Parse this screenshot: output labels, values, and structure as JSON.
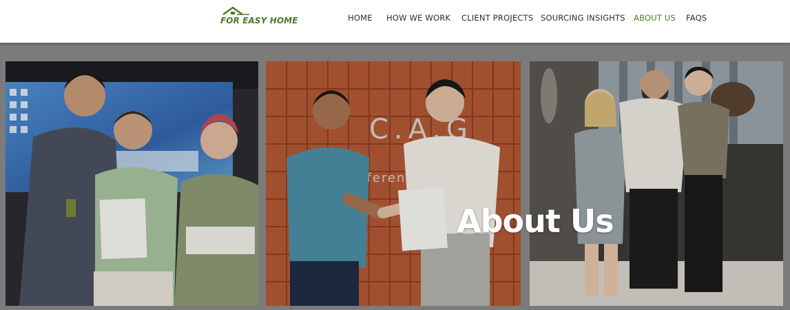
{
  "header": {
    "logo_text": "FOR EASY HOME",
    "nav": [
      {
        "label": "HOME"
      },
      {
        "label": "HOW WE WORK"
      },
      {
        "label": "CLIENT PROJECTS"
      },
      {
        "label": "SOURCING INSIGHTS"
      },
      {
        "label": "ABOUT US",
        "active": true
      },
      {
        "label": "FAQS"
      }
    ]
  },
  "hero": {
    "title": "About Us",
    "photos": [
      {
        "sign_text": ""
      },
      {
        "sign_text": "C.A.G",
        "sign_subtext": "onferenc"
      },
      {
        "sign_text": ""
      }
    ]
  },
  "colors": {
    "accent_green": "#4a7a22",
    "hero_background": "#8a8a8a",
    "nav_text": "#2b2b2b"
  }
}
